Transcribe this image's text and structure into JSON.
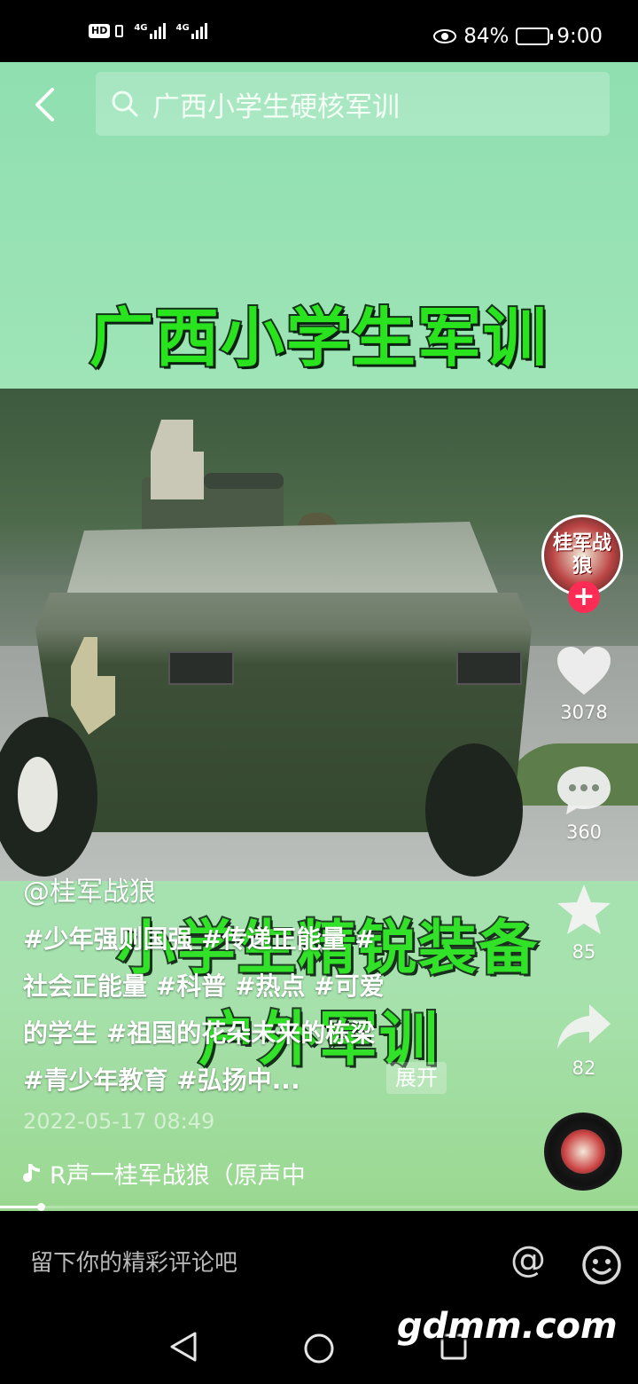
{
  "status_bar": {
    "hd": "HD",
    "net1": "4G",
    "net2": "4G",
    "battery_pct": "84%",
    "time": "9:00"
  },
  "search": {
    "query": "广西小学生硬核军训"
  },
  "video": {
    "title_top": "广西小学生军训",
    "title_mid": "小学生精锐装备",
    "title_low": "户外军训"
  },
  "rail": {
    "avatar_text": "桂军战狼",
    "follow_symbol": "+",
    "likes": "3078",
    "comments": "360",
    "favorites": "85",
    "shares": "82"
  },
  "caption": {
    "author": "@桂军战狼",
    "lines": [
      "#少年强则国强 #传递正能量 #",
      "社会正能量 #科普 #热点 #可爱",
      "的学生 #祖国的花朵未来的栋梁",
      "#青少年教育 #弘扬中..."
    ],
    "expand": "展开",
    "timestamp": "2022-05-17 08:49",
    "music": "R声一桂军战狼（原声中"
  },
  "progress": {
    "fraction": 0.06
  },
  "comment_bar": {
    "placeholder": "留下你的精彩评论吧",
    "at_symbol": "@"
  },
  "watermark": "gdmm.com",
  "colors": {
    "title_green": "#28e31e",
    "follow_red": "#fe2c55"
  }
}
